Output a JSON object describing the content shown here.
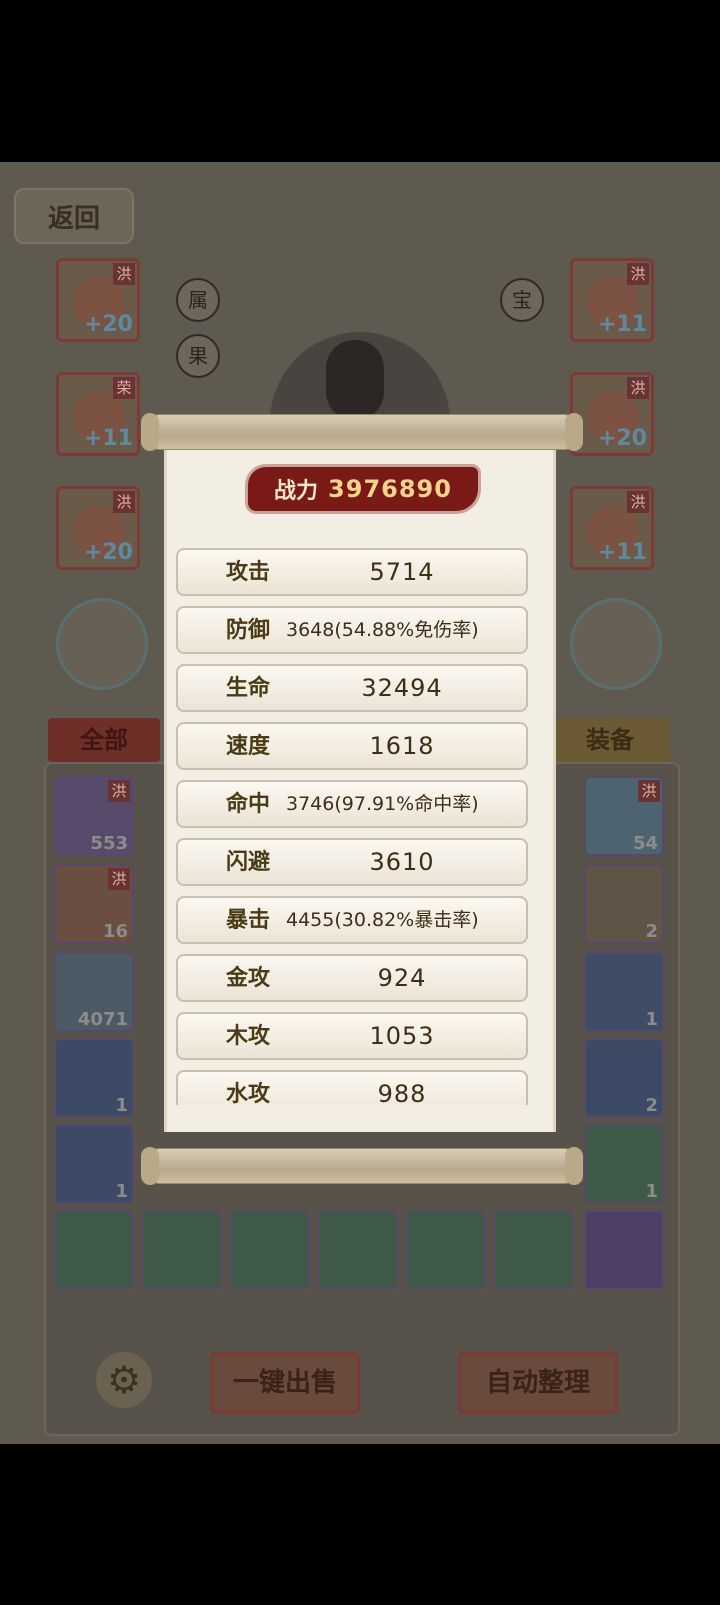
{
  "header": {
    "back_label": "返回"
  },
  "equip_slots": [
    {
      "tag": "洪",
      "level": "+20"
    },
    {
      "tag": "荣",
      "level": "+11"
    },
    {
      "tag": "洪",
      "level": "+20"
    },
    {
      "tag": "洪",
      "level": "+11"
    },
    {
      "tag": "洪",
      "level": "+20"
    },
    {
      "tag": "洪",
      "level": "+11"
    }
  ],
  "side_buttons": {
    "attr_line1": "属",
    "attr_line2": "果",
    "treasure": "宝"
  },
  "tabs": {
    "all": "全部",
    "equip": "装备"
  },
  "inventory": [
    {
      "tag": "洪",
      "count": "553"
    },
    {
      "tag": "洪",
      "count": "54"
    },
    {
      "tag": "洪",
      "count": "16"
    },
    {
      "tag": "",
      "count": "2"
    },
    {
      "tag": "",
      "count": "4071"
    },
    {
      "tag": "",
      "count": "1"
    },
    {
      "tag": "",
      "count": "1"
    },
    {
      "tag": "",
      "count": "2"
    },
    {
      "tag": "",
      "count": "1"
    },
    {
      "tag": "",
      "count": "1"
    }
  ],
  "bottom_buttons": {
    "sell_all": "一键出售",
    "auto_sort": "自动整理"
  },
  "popup": {
    "power_label": "战力",
    "power_value": "3976890",
    "stats": [
      {
        "name": "攻击",
        "value": "5714"
      },
      {
        "name": "防御",
        "value": "3648(54.88%免伤率)"
      },
      {
        "name": "生命",
        "value": "32494"
      },
      {
        "name": "速度",
        "value": "1618"
      },
      {
        "name": "命中",
        "value": "3746(97.91%命中率)"
      },
      {
        "name": "闪避",
        "value": "3610"
      },
      {
        "name": "暴击",
        "value": "4455(30.82%暴击率)"
      },
      {
        "name": "金攻",
        "value": "924"
      },
      {
        "name": "木攻",
        "value": "1053"
      },
      {
        "name": "水攻",
        "value": "988"
      }
    ]
  },
  "colors": {
    "power_banner": "#7a1a16",
    "power_text": "#f3d38e",
    "stat_name": "#4a3a16",
    "paper": "#f2eee4"
  }
}
